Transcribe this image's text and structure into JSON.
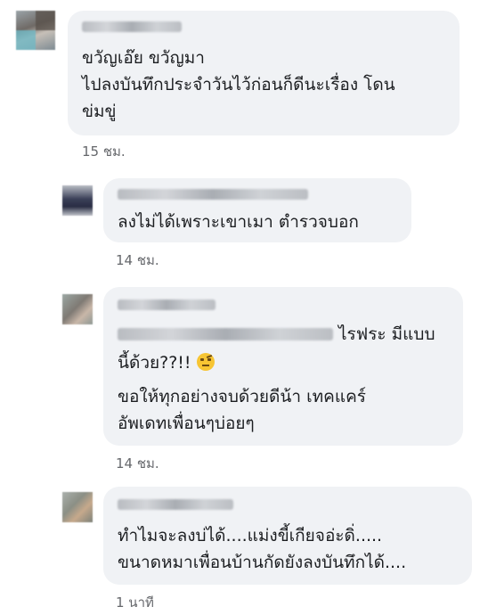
{
  "comments": [
    {
      "lines": [
        "ขวัญเอ๊ย ขวัญมา",
        "ไปลงบันทึกประจำวันไว้ก่อนก็ดีนะเรื่อง โดน",
        "ข่มขู่"
      ],
      "time": "15 ชม."
    },
    {
      "lines": [
        "ลงไม่ได้เพราะเขาเมา ตำรวจบอก"
      ],
      "time": "14 ชม."
    },
    {
      "line1_suffix": "ไรฟระ มีแบบ",
      "line2": "นี้ด้วย??!!",
      "emoji": "face-with-raised-eyebrow-icon",
      "line3": "ขอให้ทุกอย่างจบด้วยดีน้า เทคแคร์",
      "line4": "อัพเดทเพื่อนๆบ่อยๆ",
      "time": "14 ชม."
    },
    {
      "lines": [
        "ทำไมจะลงบ่ได้....แม่งขี้เกียจอ่ะดิ่.....",
        "ขนาดหมาเพื่อนบ้านกัดยังลงบันทึกได้...."
      ],
      "time": "1 นาที"
    }
  ],
  "colors": {
    "bubble": "#f0f2f5",
    "text": "#1c1e21",
    "meta": "#65676b"
  }
}
